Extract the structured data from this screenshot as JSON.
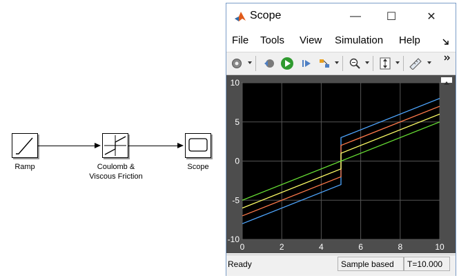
{
  "model": {
    "blocks": {
      "ramp": {
        "label": "Ramp"
      },
      "friction": {
        "label_line1": "Coulomb &",
        "label_line2": "Viscous Friction"
      },
      "scope": {
        "label": "Scope"
      }
    }
  },
  "scope_window": {
    "title": "Scope",
    "window_buttons": {
      "minimize": "—",
      "maximize": "☐",
      "close": "✕"
    },
    "menus": [
      "File",
      "Tools",
      "View",
      "Simulation",
      "Help"
    ],
    "status": {
      "left": "Ready",
      "mode": "Sample based",
      "time": "T=10.000"
    }
  },
  "chart_data": {
    "type": "line",
    "xlim": [
      0,
      10
    ],
    "ylim": [
      -10,
      10
    ],
    "xticks": [
      0,
      2,
      4,
      6,
      8,
      10
    ],
    "yticks": [
      -10,
      -5,
      0,
      5,
      10
    ],
    "grid": true,
    "background": "#000000",
    "series": [
      {
        "color": "#4ea6ff",
        "x": [
          0,
          5,
          5,
          10
        ],
        "y": [
          -8,
          -3,
          3,
          8
        ]
      },
      {
        "color": "#ff7a4a",
        "x": [
          0,
          5,
          5,
          10
        ],
        "y": [
          -7,
          -2,
          2,
          7
        ]
      },
      {
        "color": "#ffff66",
        "x": [
          0,
          5,
          5,
          10
        ],
        "y": [
          -6,
          -1,
          1,
          6
        ]
      },
      {
        "color": "#66dd33",
        "x": [
          0,
          5,
          5,
          10
        ],
        "y": [
          -5,
          0,
          0,
          5
        ]
      }
    ]
  }
}
